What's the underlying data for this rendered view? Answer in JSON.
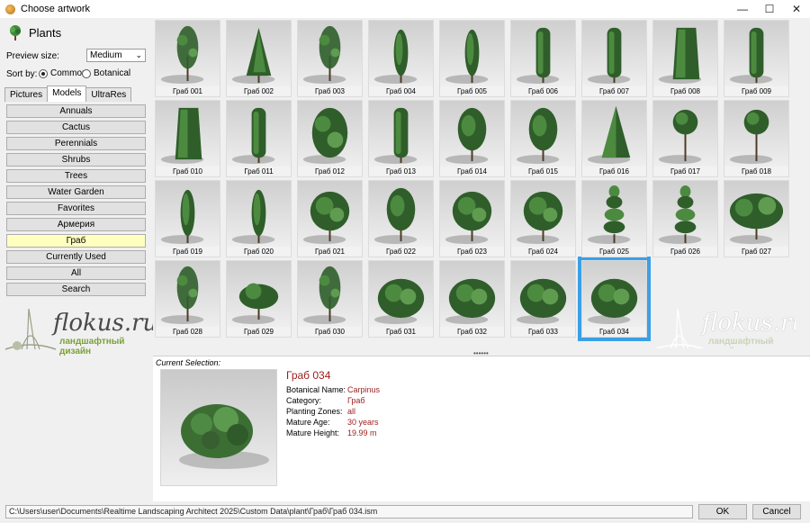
{
  "window": {
    "title": "Choose artwork",
    "minimize": "—",
    "maximize": "☐",
    "close": "✕"
  },
  "left": {
    "header": "Plants",
    "preview_size_label": "Preview size:",
    "preview_size_value": "Medium",
    "sort_by_label": "Sort by:",
    "sort_common": "Common",
    "sort_botanical": "Botanical",
    "tabs": [
      "Pictures",
      "Models",
      "UltraRes"
    ],
    "categories": [
      "Annuals",
      "Cactus",
      "Perennials",
      "Shrubs",
      "Trees",
      "Water Garden",
      "Favorites",
      "Армерия",
      "Граб",
      "Currently Used",
      "All",
      "Search"
    ]
  },
  "watermark": {
    "text": "flokus.ru",
    "sub": "ландшафтный дизайн"
  },
  "tiles": [
    {
      "label": "Граб 001",
      "shape": "sparse"
    },
    {
      "label": "Граб 002",
      "shape": "cone"
    },
    {
      "label": "Граб 003",
      "shape": "sparse"
    },
    {
      "label": "Граб 004",
      "shape": "narrow"
    },
    {
      "label": "Граб 005",
      "shape": "narrow"
    },
    {
      "label": "Граб 006",
      "shape": "column"
    },
    {
      "label": "Граб 007",
      "shape": "column"
    },
    {
      "label": "Граб 008",
      "shape": "hedge"
    },
    {
      "label": "Граб 009",
      "shape": "column"
    },
    {
      "label": "Граб 010",
      "shape": "hedge"
    },
    {
      "label": "Граб 011",
      "shape": "column"
    },
    {
      "label": "Граб 012",
      "shape": "bushy"
    },
    {
      "label": "Граб 013",
      "shape": "column"
    },
    {
      "label": "Граб 014",
      "shape": "oval"
    },
    {
      "label": "Граб 015",
      "shape": "oval"
    },
    {
      "label": "Граб 016",
      "shape": "pyramid"
    },
    {
      "label": "Граб 017",
      "shape": "lollipop"
    },
    {
      "label": "Граб 018",
      "shape": "lollipop"
    },
    {
      "label": "Граб 019",
      "shape": "narrow"
    },
    {
      "label": "Граб 020",
      "shape": "narrow"
    },
    {
      "label": "Граб 021",
      "shape": "round"
    },
    {
      "label": "Граб 022",
      "shape": "oval"
    },
    {
      "label": "Граб 023",
      "shape": "round"
    },
    {
      "label": "Граб 024",
      "shape": "round"
    },
    {
      "label": "Граб 025",
      "shape": "spiral"
    },
    {
      "label": "Граб 026",
      "shape": "spiral"
    },
    {
      "label": "Граб 027",
      "shape": "wide"
    },
    {
      "label": "Граб 028",
      "shape": "sparse"
    },
    {
      "label": "Граб 029",
      "shape": "shrub"
    },
    {
      "label": "Граб 030",
      "shape": "sparse"
    },
    {
      "label": "Граб 031",
      "shape": "mound"
    },
    {
      "label": "Граб 032",
      "shape": "mound"
    },
    {
      "label": "Граб 033",
      "shape": "mound"
    },
    {
      "label": "Граб 034",
      "shape": "mound"
    }
  ],
  "selected_index": 33,
  "detail": {
    "current_selection_label": "Current Selection:",
    "name": "Граб 034",
    "props": [
      {
        "key": "Botanical Name:",
        "value": "Carpinus"
      },
      {
        "key": "Category:",
        "value": "Граб"
      },
      {
        "key": "Planting Zones:",
        "value": "all"
      },
      {
        "key": "Mature Age:",
        "value": "30 years"
      },
      {
        "key": "Mature Height:",
        "value": "19.99 m"
      }
    ]
  },
  "footer": {
    "path": "C:\\Users\\user\\Documents\\Realtime Landscaping Architect 2025\\Custom Data\\plant\\Граб\\Граб 034.ism",
    "ok": "OK",
    "cancel": "Cancel"
  },
  "colors": {
    "accent": "#3aa0e6",
    "value_red": "#9b1c1c",
    "selected_category": "#ffffc0"
  }
}
